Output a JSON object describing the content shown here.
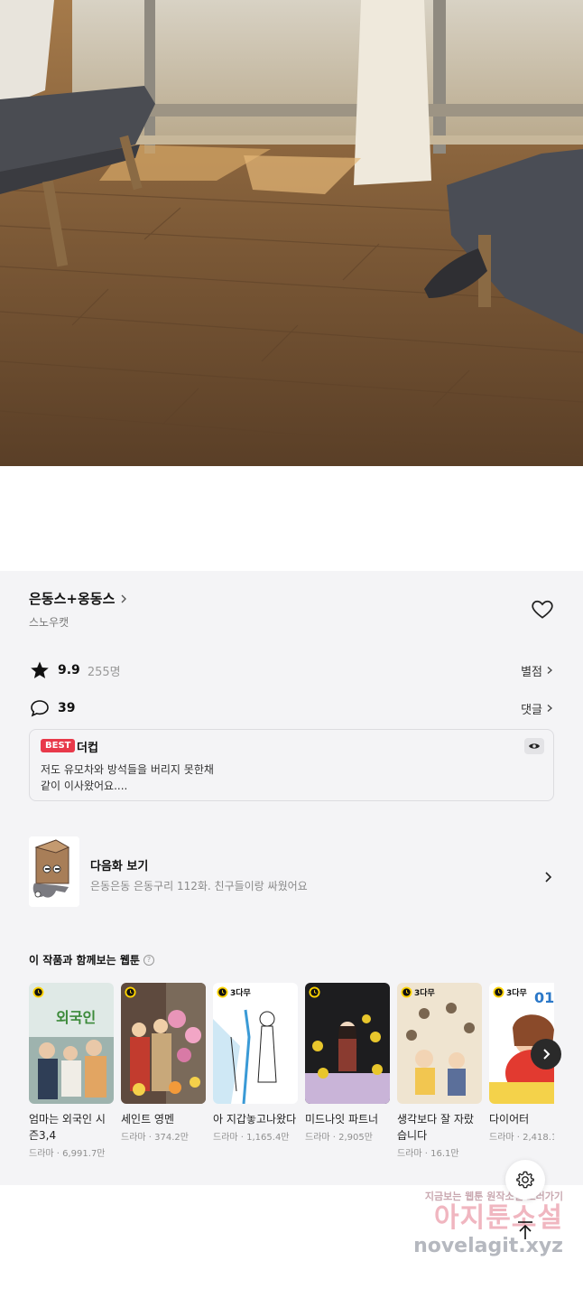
{
  "work": {
    "title": "은동스+옹동스",
    "author": "스노우캣",
    "rating": "9.9",
    "rating_count": "255명",
    "rating_link": "별점",
    "comment_count": "39",
    "comment_link": "댓글"
  },
  "best_comment": {
    "badge": "BEST",
    "user": "더컵",
    "line1": "저도 유모차와 방석들을 버리지 못한채",
    "line2": "같이 이사왔어요...."
  },
  "next_episode": {
    "label": "다음화 보기",
    "description": "은동은동 은동구리 112화. 친구들이랑 싸웠어요"
  },
  "recommendations": {
    "title": "이 작품과 함께보는 웹툰",
    "help": "?",
    "items": [
      {
        "title": "엄마는 외국인 시즌3,4",
        "meta": "드라마 · 6,991.7만",
        "badge": ""
      },
      {
        "title": "세인트 영멘",
        "meta": "드라마 · 374.2만",
        "badge": ""
      },
      {
        "title": "아 지갑놓고나왔다",
        "meta": "드라마 · 1,165.4만",
        "badge": "3다무"
      },
      {
        "title": "미드나잇 파트너",
        "meta": "드라마 · 2,905만",
        "badge": ""
      },
      {
        "title": "생각보다 잘 자랐습니다",
        "meta": "드라마 · 16.1만",
        "badge": "3다무"
      },
      {
        "title": "다이어터",
        "meta": "드라마 · 2,418.1",
        "badge": "3다무"
      }
    ]
  },
  "watermark": {
    "line1": "지금보는 웹툰 원작소설 보러가기",
    "line2": "아지툰소설",
    "line3": "novelagit.xyz"
  },
  "icons": [
    "star-icon",
    "comment-icon",
    "heart-icon",
    "eye-icon",
    "chevron-right-icon",
    "gear-icon",
    "arrow-up-icon",
    "clock-icon"
  ],
  "colors": {
    "best_badge": "#e8394a",
    "panel_bg": "#f4f4f6"
  }
}
